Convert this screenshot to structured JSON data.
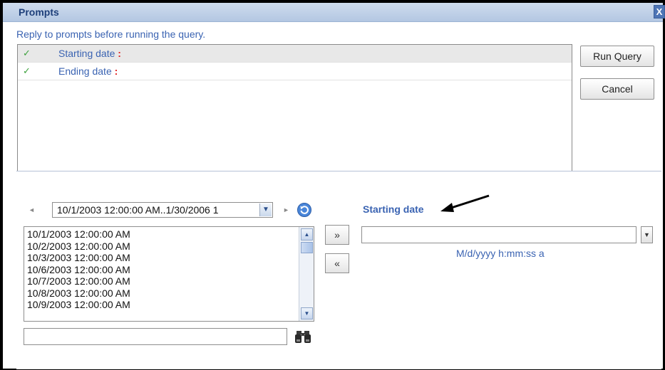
{
  "dialog": {
    "title": "Prompts",
    "close_glyph": "X",
    "instructions": "Reply to prompts before running the query."
  },
  "prompts": [
    {
      "check": "✓",
      "label": "Starting date",
      "required_marker": ":",
      "status": "answered",
      "selected": true
    },
    {
      "check": "✓",
      "label": "Ending date",
      "required_marker": ":",
      "status": "answered",
      "selected": false
    }
  ],
  "buttons": {
    "run_query": "Run Query",
    "cancel": "Cancel",
    "add": "»",
    "remove": "«"
  },
  "lov": {
    "range_value": "10/1/2003 12:00:00 AM..1/30/2006 1",
    "prev_glyph": "◄",
    "next_glyph": "►",
    "values": [
      "10/1/2003 12:00:00 AM",
      "10/2/2003 12:00:00 AM",
      "10/3/2003 12:00:00 AM",
      "10/6/2003 12:00:00 AM",
      "10/7/2003 12:00:00 AM",
      "10/8/2003 12:00:00 AM",
      "10/9/2003 12:00:00 AM"
    ],
    "search_value": ""
  },
  "answer": {
    "label": "Starting date",
    "value": "",
    "format_hint": "M/d/yyyy h:mm:ss a"
  },
  "icons": {
    "refresh": "refresh-icon",
    "search": "binoculars-icon",
    "pointer": "arrow-annotation"
  },
  "colors": {
    "accent_text": "#3a63b2",
    "required_marker": "#e02020",
    "check": "#3da13d",
    "title_text": "#1e3f7a"
  }
}
